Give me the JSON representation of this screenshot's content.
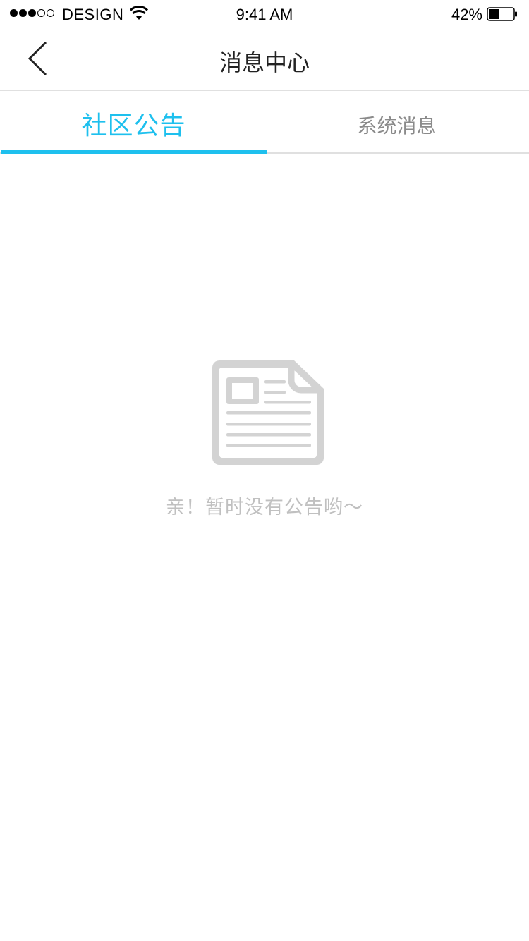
{
  "status_bar": {
    "carrier": "DESIGN",
    "time": "9:41 AM",
    "battery": "42%",
    "battery_level": 0.42
  },
  "nav": {
    "title": "消息中心",
    "back_icon": "chevron-left-icon"
  },
  "tabs": [
    {
      "label": "社区公告",
      "active": true
    },
    {
      "label": "系统消息",
      "active": false
    }
  ],
  "empty_state": {
    "icon": "document-icon",
    "message": "亲！暂时没有公告哟～"
  },
  "colors": {
    "accent": "#1ec0ee",
    "inactive_text": "#8a8a8a",
    "placeholder": "#c0c0c0",
    "icon_gray": "#d3d3d3"
  }
}
